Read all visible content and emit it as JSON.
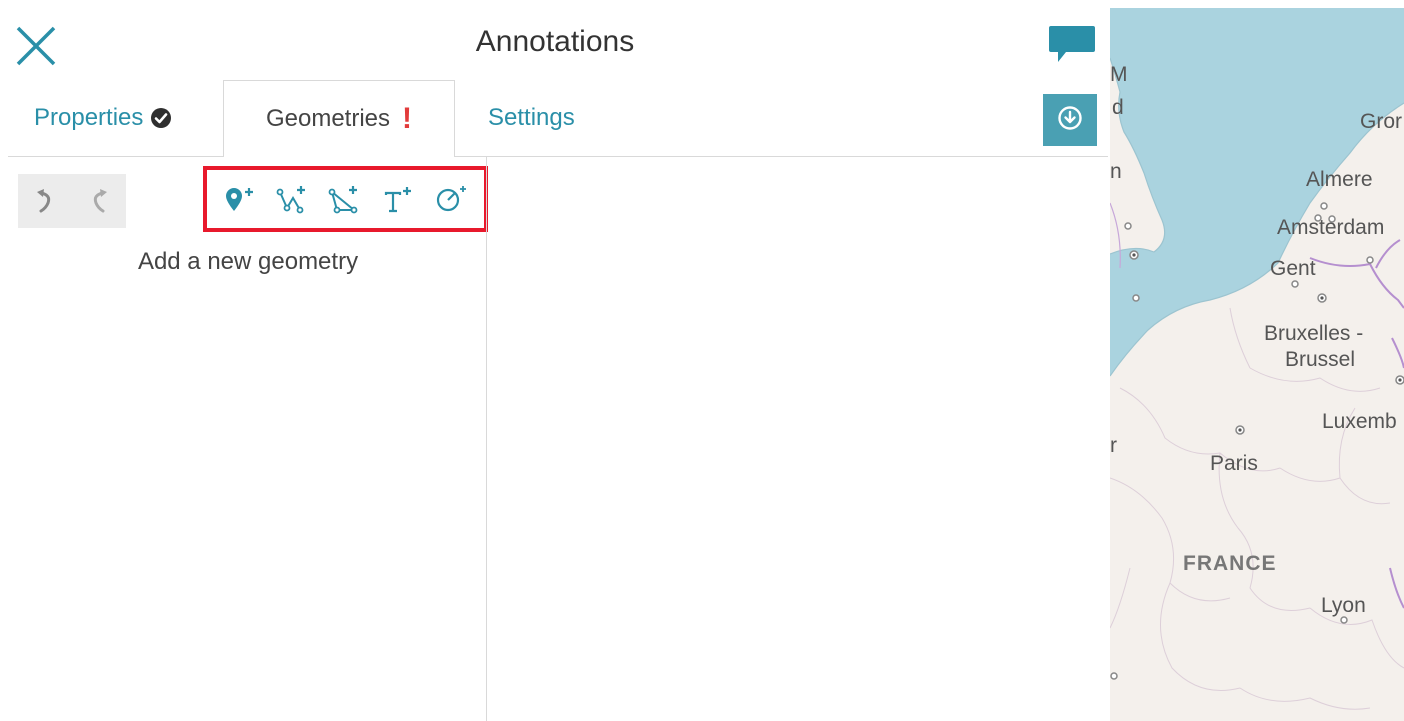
{
  "panel": {
    "title": "Annotations"
  },
  "tabs": {
    "properties": "Properties",
    "geometries": "Geometries",
    "geometries_warning": "!",
    "settings": "Settings"
  },
  "hint": "Add a new geometry",
  "map": {
    "labels": {
      "m_left": "M",
      "d_left": "d",
      "gron": "Gror",
      "n_left": "n",
      "almere": "Almere",
      "amsterdam": "Amsterdam",
      "gent": "Gent",
      "bruxelles_1": "Bruxelles -",
      "bruxelles_2": "Brussel",
      "luxembourg": "Luxemb",
      "r_left": "r",
      "paris": "Paris",
      "france": "FRANCE",
      "lyon": "Lyon"
    }
  },
  "icons": [
    "close-icon",
    "comment-icon",
    "download-icon",
    "check-circle-icon",
    "undo-icon",
    "redo-icon",
    "add-point-icon",
    "add-line-icon",
    "add-polygon-icon",
    "add-text-icon",
    "add-circle-icon"
  ],
  "colors": {
    "accent": "#2a8fa8",
    "button": "#4aa0b3",
    "warning": "#e23b3b",
    "highlight": "#e8192c",
    "sea": "#aad3df"
  }
}
